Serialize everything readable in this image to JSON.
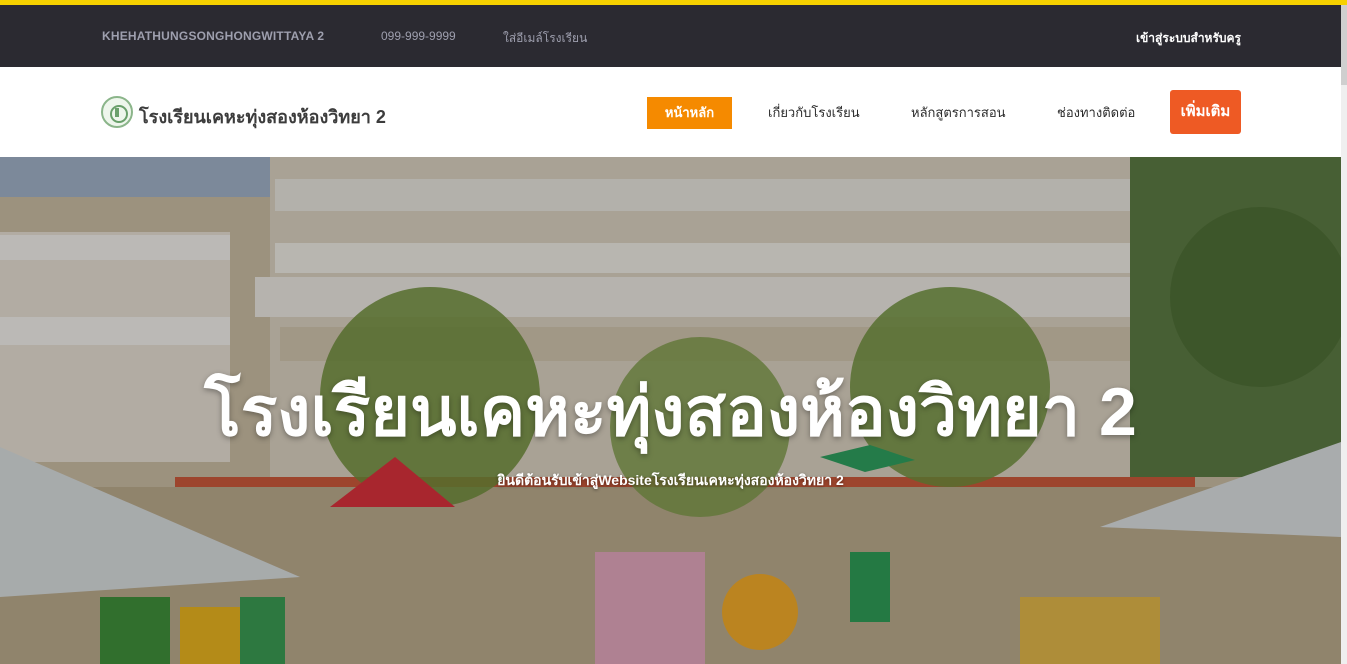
{
  "topbar": {
    "school_name": "KHEHATHUNGSONGHONGWITTAYA 2",
    "phone": "099-999-9999",
    "email_label": "ใส่อีเมล์โรงเรียน",
    "teacher_login": "เข้าสู่ระบบสำหรับครู"
  },
  "navbar": {
    "logo_text": "โรงเรียนเคหะทุ่งสองห้องวิทยา 2",
    "links": [
      {
        "label": "หน้าหลัก",
        "active": true
      },
      {
        "label": "เกี่ยวกับโรงเรียน",
        "active": false
      },
      {
        "label": "หลักสูตรการสอน",
        "active": false
      },
      {
        "label": "ช่องทางติดต่อ",
        "active": false
      }
    ],
    "more_button": "เพิ่มเติม"
  },
  "hero": {
    "title": "โรงเรียนเคหะทุ่งสองห้องวิทยา 2",
    "subtitle": "ยินดีต้อนรับเข้าสู่Websiteโรงเรียนเคหะทุ่งสองห้องวิทยา 2",
    "image": "school-building-playground-photo"
  },
  "colors": {
    "accent_yellow": "#f6d100",
    "topbar_bg": "#2b2a31",
    "nav_active": "#f58a00",
    "more_button": "#ee5a24"
  }
}
